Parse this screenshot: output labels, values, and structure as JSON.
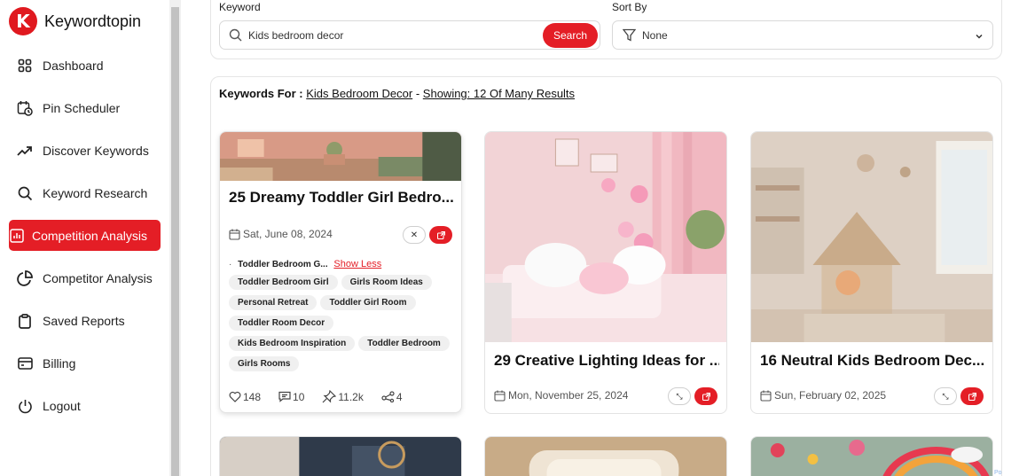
{
  "app": {
    "name": "Keywordtopin",
    "logo_letter": "K",
    "accent": "#e41e26"
  },
  "sidebar": {
    "items": [
      {
        "label": "Dashboard",
        "icon": "grid-icon"
      },
      {
        "label": "Pin Scheduler",
        "icon": "calendar-clock-icon"
      },
      {
        "label": "Discover Keywords",
        "icon": "trending-up-icon"
      },
      {
        "label": "Keyword Research",
        "icon": "search-icon"
      },
      {
        "label": "Competition Analysis",
        "icon": "bar-chart-icon",
        "active": true
      },
      {
        "label": "Competitor Analysis",
        "icon": "pie-chart-icon"
      },
      {
        "label": "Saved Reports",
        "icon": "clipboard-icon"
      },
      {
        "label": "Billing",
        "icon": "credit-card-icon"
      },
      {
        "label": "Logout",
        "icon": "power-icon"
      }
    ]
  },
  "filters": {
    "keyword_label": "Keyword",
    "keyword_value": "Kids bedroom decor",
    "search_button": "Search",
    "sort_label": "Sort By",
    "sort_value": "None"
  },
  "results": {
    "prefix": "Keywords For :",
    "keyword": "Kids Bedroom Decor",
    "separator": "-",
    "showing": "Showing: 12 Of Many Results"
  },
  "cards": [
    {
      "title": "25 Dreamy Toddler Girl Bedro...",
      "date": "Sat, June 08, 2024",
      "first_tag": "Toddler Bedroom G...",
      "show_less": "Show Less",
      "tags": [
        "Toddler Bedroom Girl",
        "Girls Room Ideas",
        "Personal Retreat",
        "Toddler Girl Room",
        "Toddler Room Decor",
        "Kids Bedroom Inspiration",
        "Toddler Bedroom",
        "Girls Rooms"
      ],
      "likes": "148",
      "comments": "10",
      "saves": "11.2k",
      "shares": "4"
    },
    {
      "title": "29 Creative Lighting Ideas for ...",
      "date": "Mon, November 25, 2024"
    },
    {
      "title": "16 Neutral Kids Bedroom Dec...",
      "date": "Sun, February 02, 2025"
    }
  ],
  "corner_text": "Po"
}
